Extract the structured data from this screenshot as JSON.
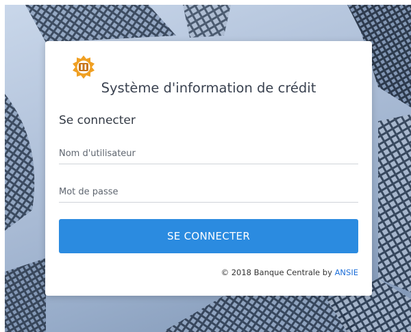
{
  "app": {
    "title": "Système d'information de crédit"
  },
  "form": {
    "heading": "Se connecter",
    "username_placeholder": "Nom d'utilisateur",
    "password_placeholder": "Mot de passe",
    "submit_label": "SE CONNECTER"
  },
  "footer": {
    "copyright": "© 2018 Banque Centrale by ",
    "link_text": "ANSIE"
  },
  "icons": {
    "logo": "bank-emblem-icon"
  },
  "colors": {
    "primary": "#2b8be0",
    "link": "#1e6fd9",
    "logo_orange": "#f0a023"
  }
}
